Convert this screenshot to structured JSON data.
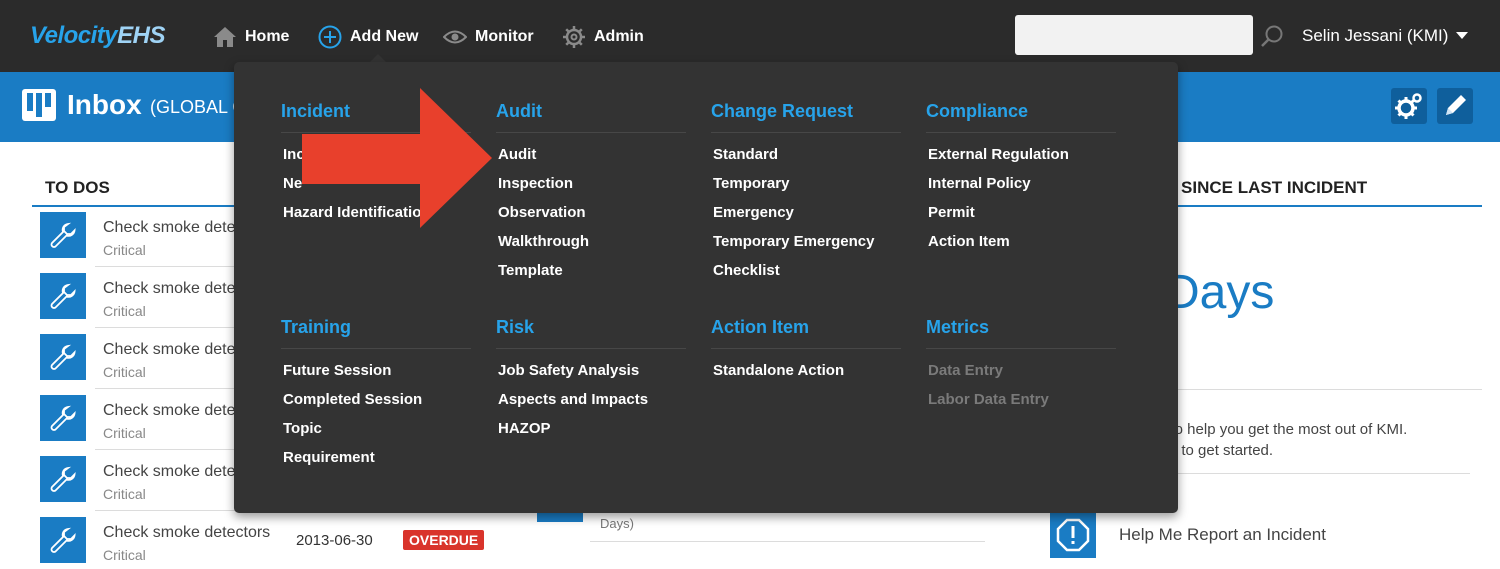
{
  "header": {
    "logo_main": "Velocity",
    "logo_sub": "EHS",
    "nav": {
      "home": "Home",
      "add_new": "Add New",
      "monitor": "Monitor",
      "admin": "Admin"
    },
    "search": {
      "value": "",
      "placeholder": ""
    },
    "user": "Selin Jessani (KMI)"
  },
  "subheader": {
    "title": "Inbox",
    "subtitle": "(GLOBAL C"
  },
  "todos": {
    "heading": "TO DOS",
    "items": [
      {
        "title": "Check smoke dete",
        "priority": "Critical"
      },
      {
        "title": "Check smoke dete",
        "priority": "Critical"
      },
      {
        "title": "Check smoke dete",
        "priority": "Critical"
      },
      {
        "title": "Check smoke dete",
        "priority": "Critical"
      },
      {
        "title": "Check smoke dete",
        "priority": "Critical"
      },
      {
        "title": "Check smoke detectors",
        "priority": "Critical",
        "date": "2013-06-30",
        "status": "OVERDUE"
      }
    ]
  },
  "middle": {
    "days_fragment": "Days)"
  },
  "right_panel": {
    "heading": "S SINCE LAST INCIDENT",
    "days_label": "Days",
    "help_line_1": "e to help you get the most out of KMI.",
    "help_line_2": "ow to get started.",
    "help_link": "Help Me Report an Incident"
  },
  "add_new_menu": {
    "columns_row1": [
      {
        "title": "Incident",
        "items": [
          "Inc",
          "Ne",
          "Hazard Identificatio"
        ]
      },
      {
        "title": "Audit",
        "items": [
          "Audit",
          "Inspection",
          "Observation",
          "Walkthrough",
          "Template"
        ]
      },
      {
        "title": "Change Request",
        "items": [
          "Standard",
          "Temporary",
          "Emergency",
          "Temporary Emergency",
          "Checklist"
        ]
      },
      {
        "title": "Compliance",
        "items": [
          "External Regulation",
          "Internal Policy",
          "Permit",
          "Action Item"
        ]
      }
    ],
    "columns_row2": [
      {
        "title": "Training",
        "items": [
          "Future Session",
          "Completed Session",
          "Topic",
          "Requirement"
        ]
      },
      {
        "title": "Risk",
        "items": [
          "Job Safety Analysis",
          "Aspects and Impacts",
          "HAZOP"
        ]
      },
      {
        "title": "Action Item",
        "items": [
          "Standalone Action"
        ]
      },
      {
        "title": "Metrics",
        "items": [
          "Data Entry",
          "Labor Data Entry"
        ],
        "disabled": true
      }
    ]
  },
  "colors": {
    "topbar": "#2b2b2b",
    "brand_blue": "#1a7cc4",
    "menu_bg": "#333333",
    "menu_heading": "#27a3ea",
    "overdue_red": "#d9342b",
    "arrow_red": "#e8402c"
  }
}
